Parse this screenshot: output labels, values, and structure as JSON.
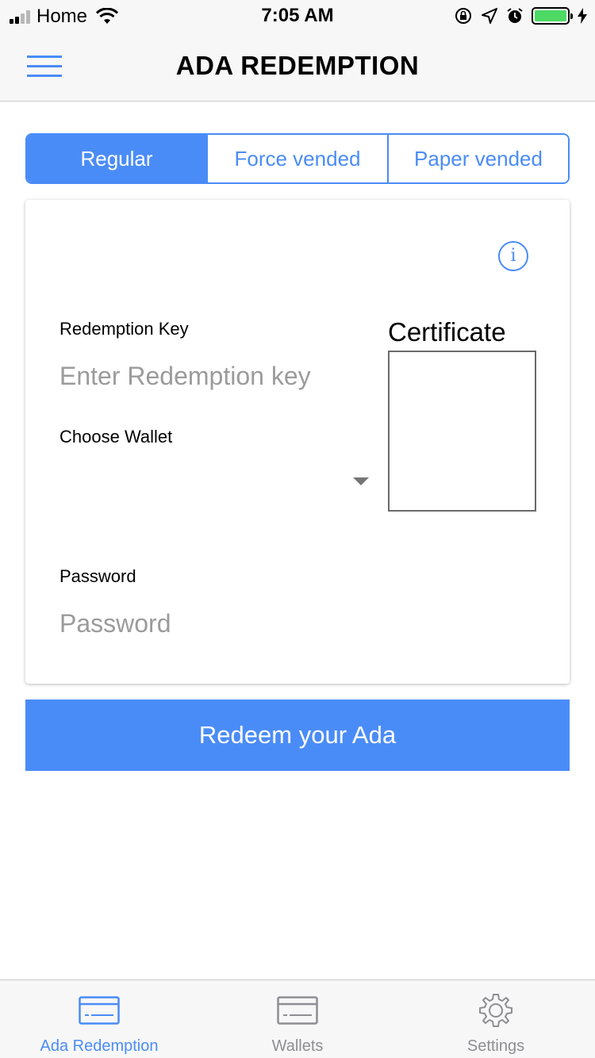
{
  "status_bar": {
    "carrier": "Home",
    "time": "7:05 AM"
  },
  "nav": {
    "title": "ADA REDEMPTION"
  },
  "tabs": [
    {
      "label": "Regular",
      "active": true
    },
    {
      "label": "Force vended",
      "active": false
    },
    {
      "label": "Paper vended",
      "active": false
    }
  ],
  "form": {
    "redemption_key_label": "Redemption Key",
    "redemption_key_placeholder": "Enter Redemption key",
    "redemption_key_value": "",
    "choose_wallet_label": "Choose Wallet",
    "choose_wallet_value": "",
    "password_label": "Password",
    "password_placeholder": "Password",
    "password_value": "",
    "certificate_label": "Certificate",
    "info_icon": "i"
  },
  "redeem_button": {
    "label": "Redeem your Ada"
  },
  "tab_bar": [
    {
      "label": "Ada Redemption",
      "icon": "card-icon",
      "active": true
    },
    {
      "label": "Wallets",
      "icon": "wallet-card-icon",
      "active": false
    },
    {
      "label": "Settings",
      "icon": "gear-icon",
      "active": false
    }
  ],
  "colors": {
    "accent": "#4a8cf7",
    "inactive": "#8e8e93",
    "battery": "#4cd964"
  }
}
